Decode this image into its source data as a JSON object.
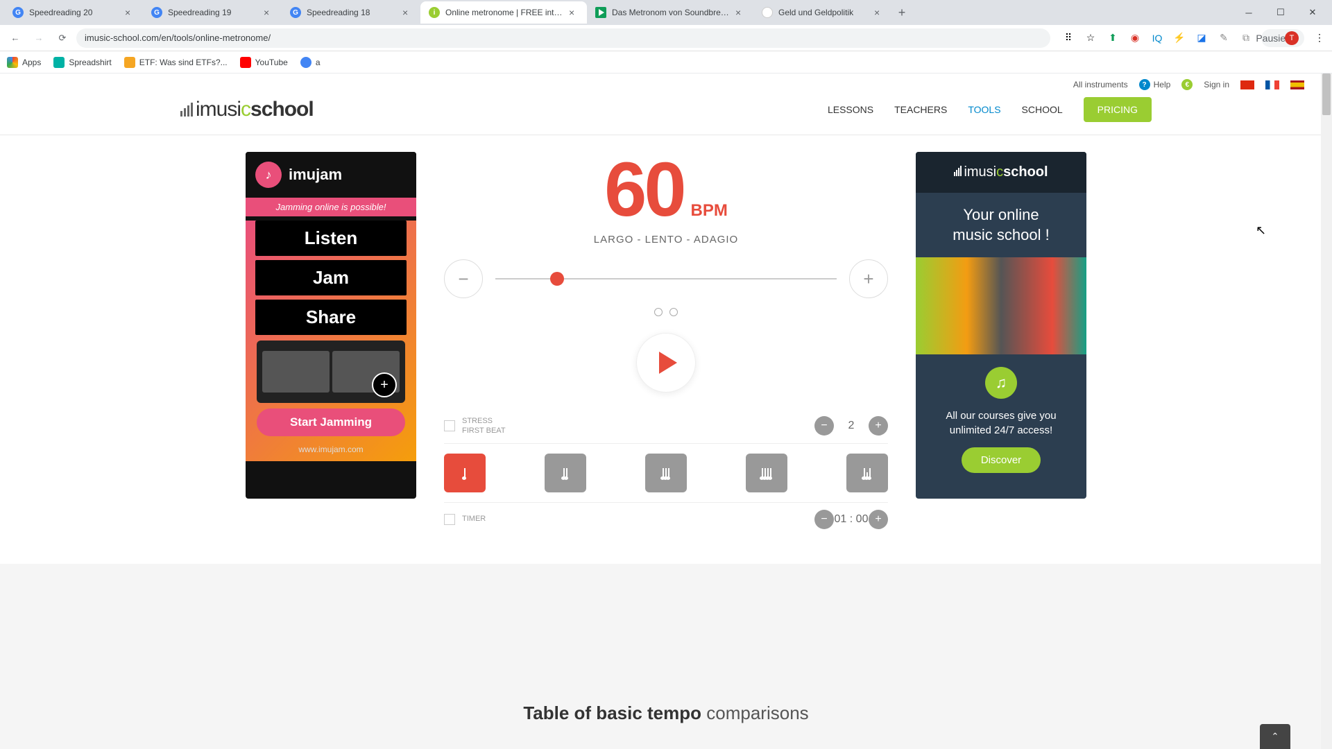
{
  "browser": {
    "tabs": [
      {
        "title": "Speedreading 20",
        "active": false
      },
      {
        "title": "Speedreading 19",
        "active": false
      },
      {
        "title": "Speedreading 18",
        "active": false
      },
      {
        "title": "Online metronome | FREE intera",
        "active": true
      },
      {
        "title": "Das Metronom von Soundbrenn",
        "active": false
      },
      {
        "title": "Geld und Geldpolitik",
        "active": false
      }
    ],
    "url": "imusic-school.com/en/tools/online-metronome/",
    "profile_label": "Pausiert",
    "profile_initial": "T"
  },
  "bookmarks": [
    {
      "label": "Apps",
      "color": "#5f6368"
    },
    {
      "label": "Spreadshirt",
      "color": "#00b2a5"
    },
    {
      "label": "ETF: Was sind ETFs?...",
      "color": "#f5a623"
    },
    {
      "label": "YouTube",
      "color": "#ff0000"
    },
    {
      "label": "a",
      "color": "#4285f4"
    }
  ],
  "utility": {
    "all_instruments": "All instruments",
    "help": "Help",
    "sign_in": "Sign in"
  },
  "nav": {
    "items": [
      "LESSONS",
      "TEACHERS",
      "TOOLS",
      "SCHOOL"
    ],
    "active_index": 2,
    "pricing": "PRICING"
  },
  "left_ad": {
    "brand": "imujam",
    "tagline": "Jamming online is possible!",
    "stripes": [
      "Listen",
      "Jam",
      "Share"
    ],
    "cta": "Start Jamming",
    "url": "www.imujam.com"
  },
  "metronome": {
    "bpm": "60",
    "bpm_label": "BPM",
    "tempo_name": "LARGO - LENTO - ADAGIO",
    "beat_count": 2,
    "stress_label_1": "STRESS",
    "stress_label_2": "FIRST BEAT",
    "beats_value": "2",
    "timer_label": "TIMER",
    "timer_value": "01 : 00",
    "subdivisions": 5,
    "active_subdivision": 0
  },
  "right_ad": {
    "headline_1": "Your online",
    "headline_2": "music school !",
    "subtext_1": "All our courses give you",
    "subtext_2": "unlimited 24/7 access!",
    "cta": "Discover"
  },
  "footer": {
    "heading_bold": "Table of basic tempo",
    "heading_rest": " comparisons"
  }
}
